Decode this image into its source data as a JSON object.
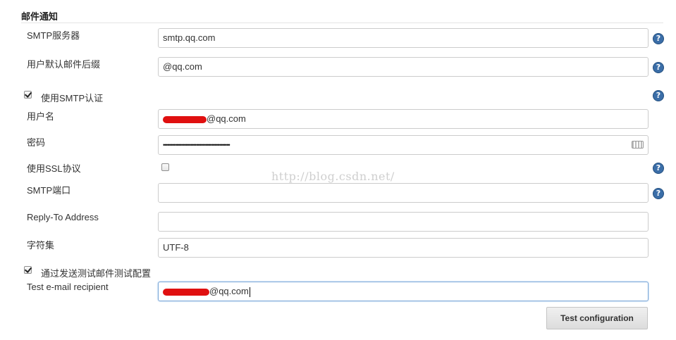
{
  "section": {
    "title": "邮件通知"
  },
  "smtp_server": {
    "label": "SMTP服务器",
    "value": "smtp.qq.com"
  },
  "default_suffix": {
    "label": "用户默认邮件后缀",
    "value": "@qq.com"
  },
  "smtp_auth": {
    "label": "使用SMTP认证",
    "checked": true
  },
  "username": {
    "label": "用户名",
    "value_suffix": "@qq.com"
  },
  "password": {
    "label": "密码",
    "masked": "••••••••••••••••••••••••••••••••••••••••••••"
  },
  "ssl": {
    "label": "使用SSL协议",
    "checked": false
  },
  "smtp_port": {
    "label": "SMTP端口",
    "value": ""
  },
  "reply_to": {
    "label": "Reply-To Address",
    "value": ""
  },
  "charset": {
    "label": "字符集",
    "value": "UTF-8"
  },
  "test_email": {
    "label": "通过发送测试邮件测试配置",
    "checked": true
  },
  "test_recipient": {
    "label": "Test e-mail recipient",
    "value_suffix": "@qq.com"
  },
  "test_button": {
    "label": "Test configuration"
  },
  "watermark": {
    "text": "http://blog.csdn.net/"
  },
  "colors": {
    "help_icon": "#3b6ea8",
    "redaction": "#e01010",
    "focus_border": "#7aa7d8"
  },
  "icons": {
    "help": "help-icon",
    "keyboard": "keyboard-icon",
    "checkbox": "checkbox"
  }
}
